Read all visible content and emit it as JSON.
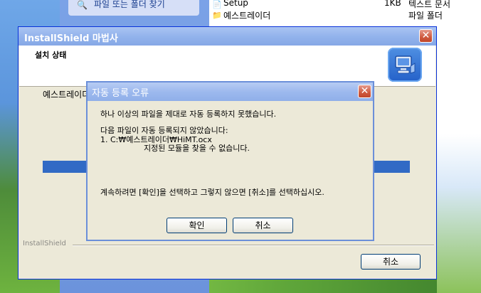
{
  "explorer": {
    "task_label": "파일 또는 폴더 찾기",
    "files": [
      {
        "name": "Setup",
        "size": "1KB",
        "type": "텍스트 문서"
      },
      {
        "name": "예스트레이더",
        "size": "",
        "type": "파일 폴더"
      }
    ]
  },
  "wizard": {
    "title": "InstallShield 마법사",
    "header_title": "설치 상태",
    "status_text": "예스트레이더",
    "progress_fraction": 1.0,
    "brand": "InstallShield",
    "cancel_label": "취소"
  },
  "dialog": {
    "title": "자동 등록 오류",
    "message_line1": "하나 이상의 파일을 제대로 자동 등록하지 못했습니다.",
    "message_line2": "다음 파일이 자동 등록되지 않았습니다:",
    "message_line3": "1. C:₩예스트레이더₩HiMT.ocx",
    "message_line4": "지정된 모듈을 찾을 수 없습니다.",
    "message_line5": "계속하려면 [확인]을 선택하고 그렇지 않으면 [취소]를 선택하십시오.",
    "ok_label": "확인",
    "cancel_label": "취소"
  },
  "colors": {
    "titlebar_blue": "#0831d9",
    "progress_blue": "#316ac5",
    "close_red": "#c0452b"
  }
}
